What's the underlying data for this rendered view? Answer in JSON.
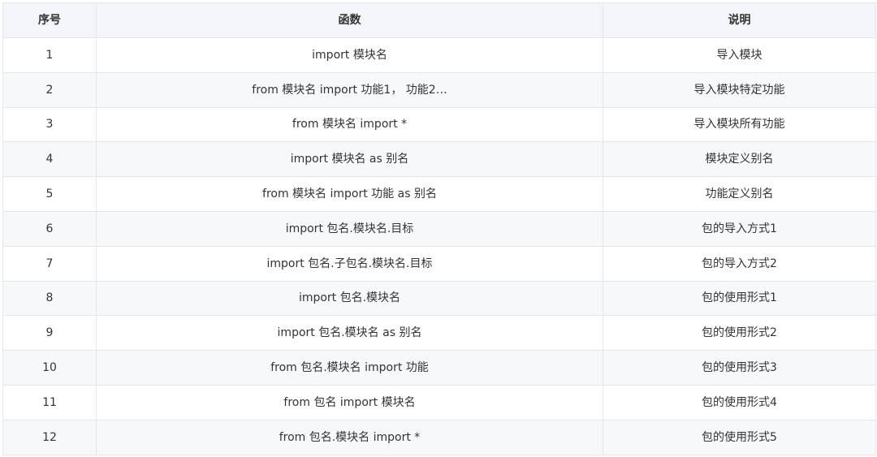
{
  "table": {
    "headers": [
      "序号",
      "函数",
      "说明"
    ],
    "rows": [
      {
        "index": "1",
        "function": "import 模块名",
        "description": "导入模块"
      },
      {
        "index": "2",
        "function": "from 模块名 import 功能1， 功能2…",
        "description": "导入模块特定功能"
      },
      {
        "index": "3",
        "function": "from 模块名 import *",
        "description": "导入模块所有功能"
      },
      {
        "index": "4",
        "function": "import 模块名 as 别名",
        "description": "模块定义别名"
      },
      {
        "index": "5",
        "function": "from 模块名 import 功能 as 别名",
        "description": "功能定义别名"
      },
      {
        "index": "6",
        "function": "import 包名.模块名.目标",
        "description": "包的导入方式1"
      },
      {
        "index": "7",
        "function": "import 包名.子包名.模块名.目标",
        "description": "包的导入方式2"
      },
      {
        "index": "8",
        "function": "import 包名.模块名",
        "description": "包的使用形式1"
      },
      {
        "index": "9",
        "function": "import 包名.模块名 as 别名",
        "description": "包的使用形式2"
      },
      {
        "index": "10",
        "function": "from 包名.模块名 import 功能",
        "description": "包的使用形式3"
      },
      {
        "index": "11",
        "function": "from 包名 import 模块名",
        "description": "包的使用形式4"
      },
      {
        "index": "12",
        "function": "from 包名.模块名 import *",
        "description": "包的使用形式5"
      }
    ]
  },
  "colors": {
    "header_bg": "#f3f5f8",
    "border": "#e3e6eb",
    "row_alt_bg": "#f7f8fa",
    "text": "#333333"
  }
}
